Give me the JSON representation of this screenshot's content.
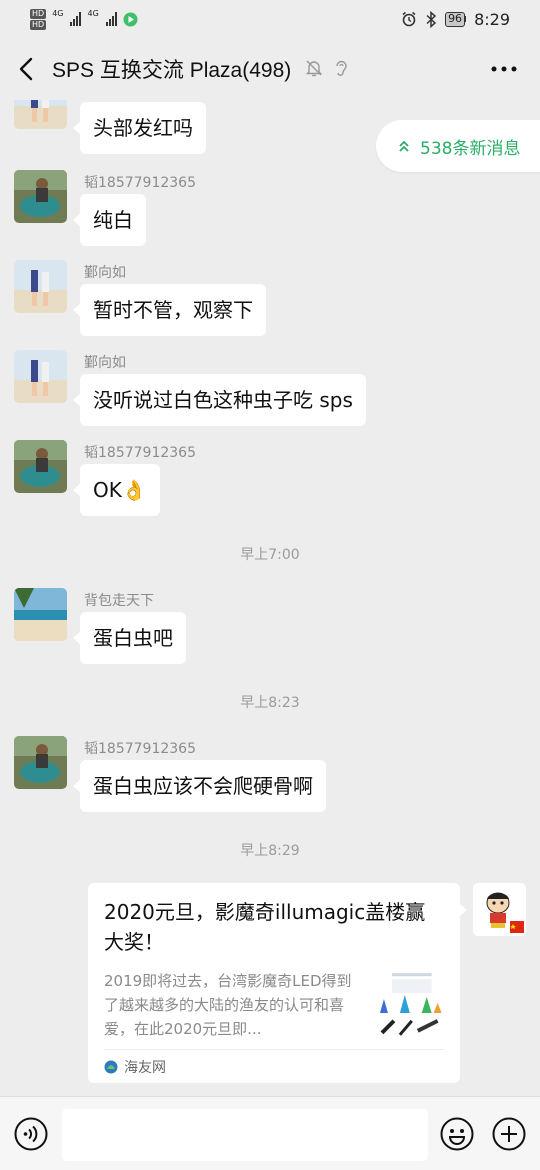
{
  "status_bar": {
    "hd_badges": [
      "HD",
      "HD"
    ],
    "network": [
      "4G",
      "4G"
    ],
    "battery": "96",
    "time": "8:29"
  },
  "header": {
    "title": "SPS 互换交流 Plaza(498)"
  },
  "new_messages": {
    "label": "538条新消息"
  },
  "messages": [
    {
      "sender": "",
      "text": "头部发红吗"
    },
    {
      "sender": "韬18577912365",
      "text": "纯白"
    },
    {
      "sender": "鄞向如",
      "text": "暂时不管，观察下"
    },
    {
      "sender": "鄞向如",
      "text": "没听说过白色这种虫子吃 sps"
    },
    {
      "sender": "韬18577912365",
      "text": "OK👌"
    },
    {
      "sender": "背包走天下",
      "text": "蛋白虫吧"
    },
    {
      "sender": "韬18577912365",
      "text": "蛋白虫应该不会爬硬骨啊"
    }
  ],
  "timestamps": [
    "早上7:00",
    "早上8:23",
    "早上8:29"
  ],
  "link_card": {
    "title": "2020元旦，影魔奇illumagic盖楼赢大奖！",
    "description": "2019即将过去，台湾影魔奇LED得到了越来越多的大陆的渔友的认可和喜爱，在此2020元旦即...",
    "source": "海友网"
  },
  "input": {
    "value": "",
    "placeholder": ""
  },
  "colors": {
    "background": "#ededed",
    "accent_green": "#2aae67",
    "bubble": "#ffffff"
  }
}
